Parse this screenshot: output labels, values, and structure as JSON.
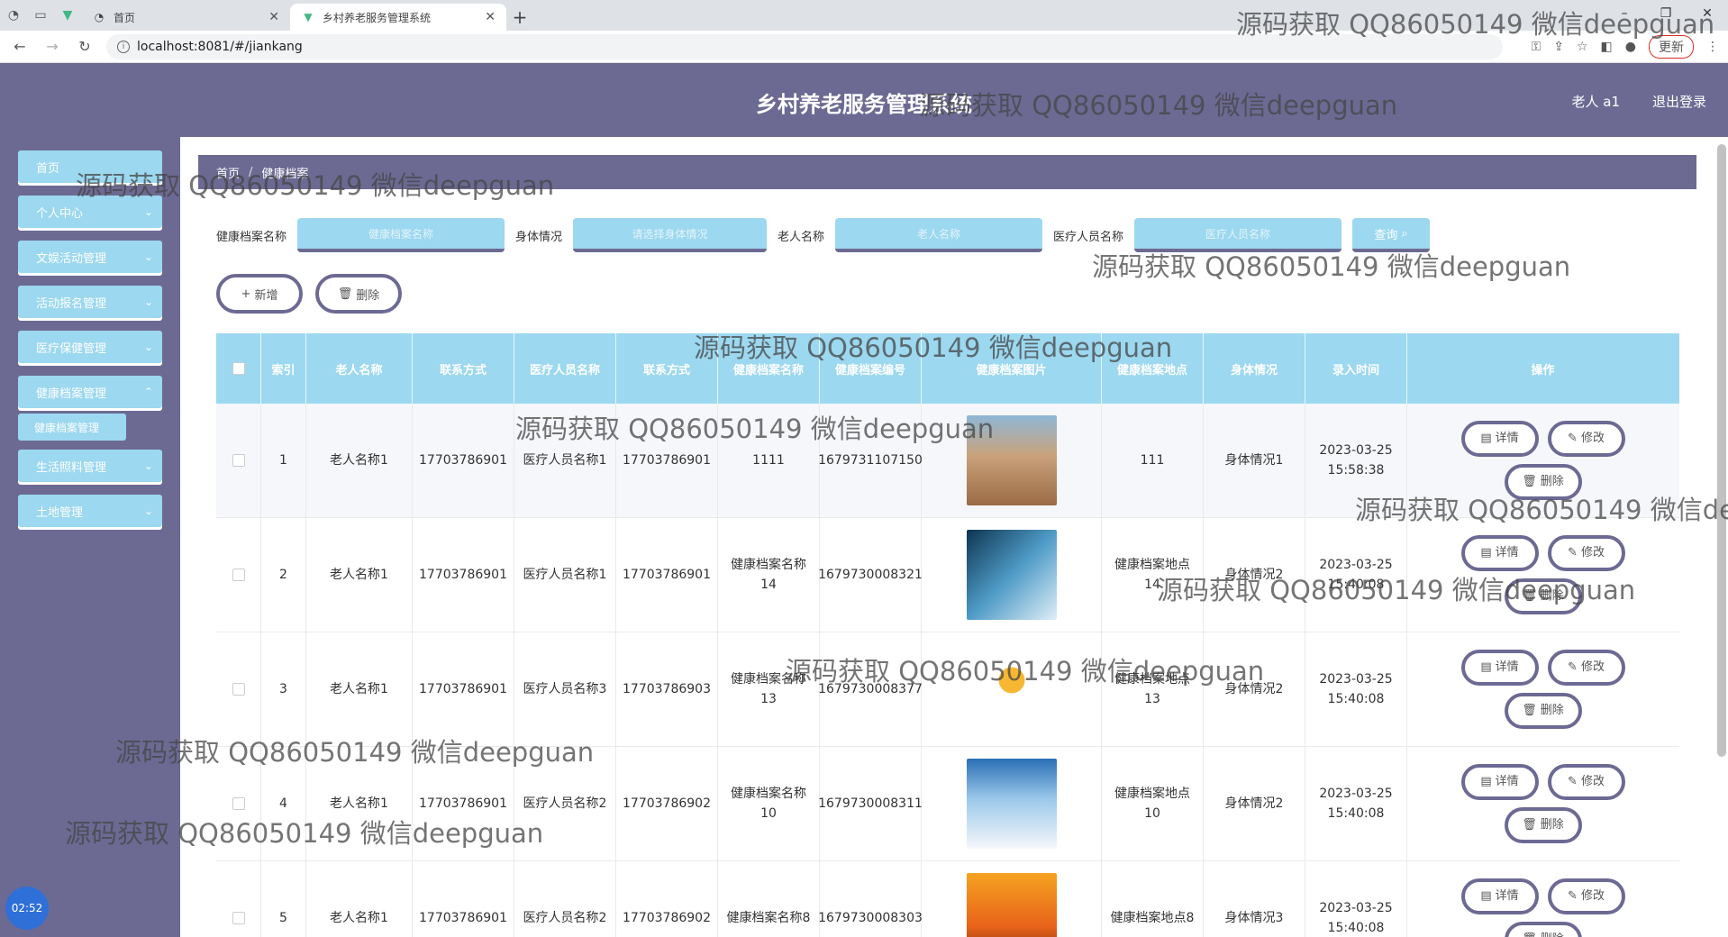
{
  "browser": {
    "tabs": [
      {
        "label": "首页",
        "active": false
      },
      {
        "label": "乡村养老服务管理系统",
        "active": true
      }
    ],
    "url": "localhost:8081/#/jiankang",
    "update_label": "更新"
  },
  "header": {
    "title": "乡村养老服务管理系统",
    "user": "老人 a1",
    "logout": "退出登录"
  },
  "sidebar": {
    "items": [
      {
        "label": "首页"
      },
      {
        "label": "个人中心"
      },
      {
        "label": "文娱活动管理"
      },
      {
        "label": "活动报名管理"
      },
      {
        "label": "医疗保健管理"
      },
      {
        "label": "健康档案管理"
      },
      {
        "label": "生活照料管理"
      },
      {
        "label": "土地管理"
      }
    ],
    "submenu": "健康档案管理"
  },
  "breadcrumb": [
    "首页",
    "健康档案"
  ],
  "search": {
    "fields": [
      {
        "label": "健康档案名称",
        "placeholder": "健康档案名称"
      },
      {
        "label": "身体情况",
        "placeholder": "请选择身体情况"
      },
      {
        "label": "老人名称",
        "placeholder": "老人名称"
      },
      {
        "label": "医疗人员名称",
        "placeholder": "医疗人员名称"
      }
    ],
    "button": "查询"
  },
  "actions": {
    "add": "新增",
    "delete": "删除"
  },
  "table": {
    "headers": [
      "",
      "索引",
      "老人名称",
      "联系方式",
      "医疗人员名称",
      "联系方式",
      "健康档案名称",
      "健康档案编号",
      "健康档案图片",
      "健康档案地点",
      "身体情况",
      "录入时间",
      "操作"
    ],
    "ops": {
      "detail": "详情",
      "edit": "修改",
      "delete": "删除"
    },
    "rows": [
      {
        "index": "1",
        "elder": "老人名称1",
        "phone": "17703786901",
        "medic": "医疗人员名称1",
        "medic_phone": "17703786901",
        "record_name": "1111",
        "record_no": "1679731107150",
        "image": "desert",
        "place": "111",
        "condition": "身体情况1",
        "time": "2023-03-25 15:58:38"
      },
      {
        "index": "2",
        "elder": "老人名称1",
        "phone": "17703786901",
        "medic": "医疗人员名称1",
        "medic_phone": "17703786901",
        "record_name": "健康档案名称14",
        "record_no": "1679730008321",
        "image": "treadmill",
        "place": "健康档案地点14",
        "condition": "身体情况2",
        "time": "2023-03-25 15:40:08"
      },
      {
        "index": "3",
        "elder": "老人名称1",
        "phone": "17703786901",
        "medic": "医疗人员名称3",
        "medic_phone": "17703786903",
        "record_name": "健康档案名称13",
        "record_no": "1679730008377",
        "image": "runner",
        "place": "健康档案地点13",
        "condition": "身体情况2",
        "time": "2023-03-25 15:40:08"
      },
      {
        "index": "4",
        "elder": "老人名称1",
        "phone": "17703786901",
        "medic": "医疗人员名称2",
        "medic_phone": "17703786902",
        "record_name": "健康档案名称10",
        "record_no": "1679730008311",
        "image": "skier",
        "place": "健康档案地点10",
        "condition": "身体情况2",
        "time": "2023-03-25 15:40:08"
      },
      {
        "index": "5",
        "elder": "老人名称1",
        "phone": "17703786901",
        "medic": "医疗人员名称2",
        "medic_phone": "17703786902",
        "record_name": "健康档案名称8",
        "record_no": "1679730008303",
        "image": "sunset-runner",
        "place": "健康档案地点8",
        "condition": "身体情况3",
        "time": "2023-03-25 15:40:08"
      }
    ]
  },
  "clock": "02:52",
  "watermark": "源码获取 QQ86050149 微信deepguan",
  "colors": {
    "primary": "#6c6a93",
    "accent": "#9cd8f0"
  }
}
